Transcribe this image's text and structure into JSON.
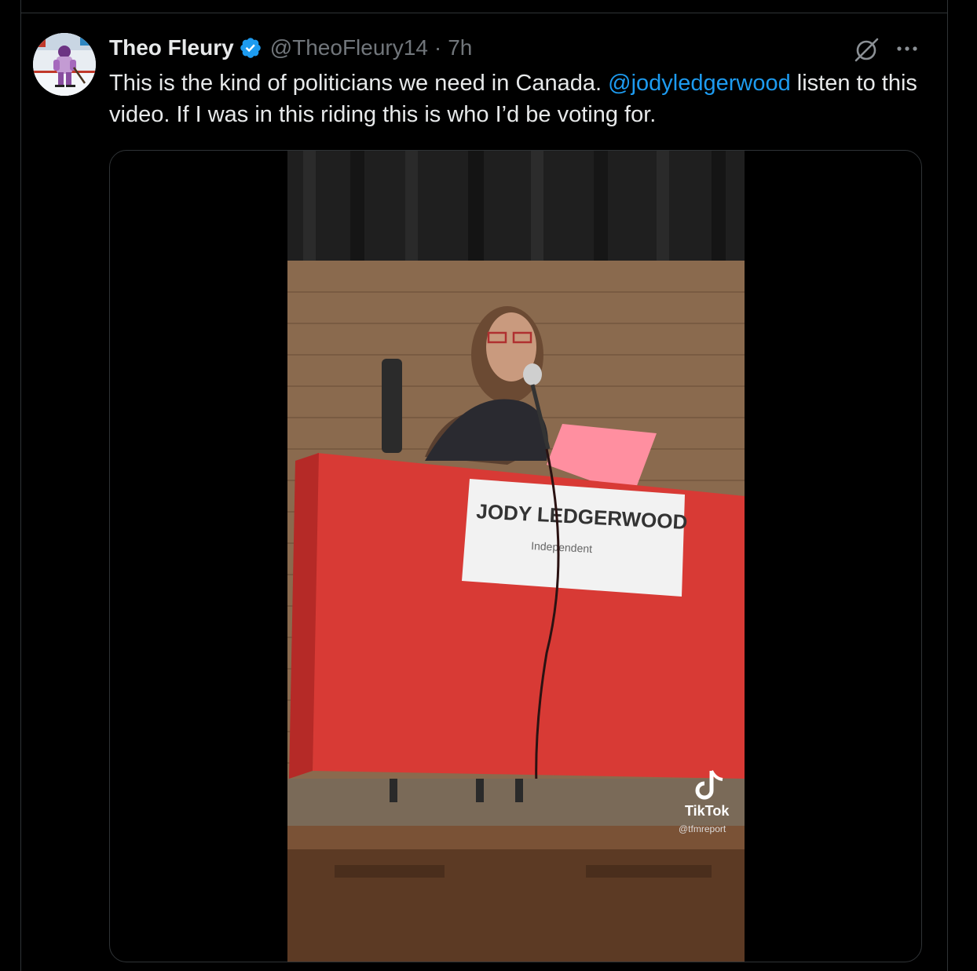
{
  "tweet": {
    "display_name": "Theo Fleury",
    "handle": "@TheoFleury14",
    "separator": "·",
    "time": "7h",
    "text_before": "This is the kind of politicians we need in Canada. ",
    "mention": "@jodyledgerwood",
    "text_after": " listen to this video. If I was in this riding this is who I’d be voting for."
  },
  "icons": {
    "verified": "verified-badge-icon",
    "grok": "grok-icon",
    "more": "more-options-icon"
  },
  "video": {
    "placard_name": "JODY LEDGERWOOD",
    "placard_subtitle": "Independent",
    "watermark_brand": "TikTok",
    "watermark_user": "@tfmreport"
  },
  "colors": {
    "background": "#000000",
    "link": "#1d9bf0",
    "muted": "#71767b",
    "border": "#2f3336",
    "verified": "#1d9bf0"
  }
}
